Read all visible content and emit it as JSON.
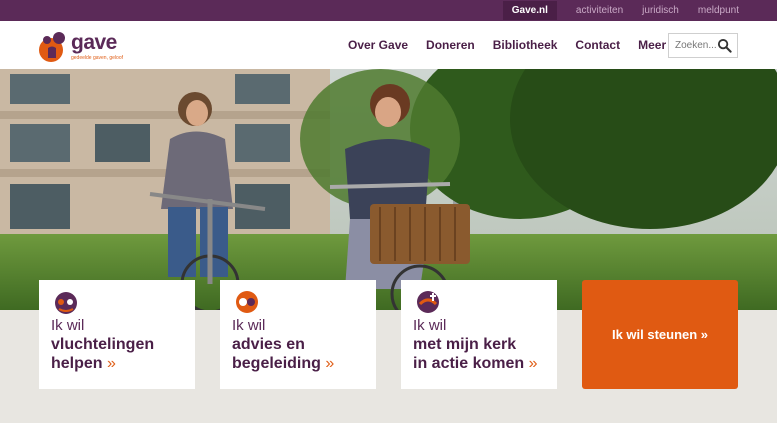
{
  "topbar": {
    "links": [
      "Gave.nl",
      "activiteiten",
      "juridisch",
      "meldpunt"
    ]
  },
  "logo": {
    "name": "gave",
    "tagline": "gedeelde gaven, geloof"
  },
  "nav": {
    "items": [
      "Over Gave",
      "Doneren",
      "Bibliotheek",
      "Contact",
      "Meer"
    ]
  },
  "search": {
    "placeholder": "Zoeken..."
  },
  "cards": [
    {
      "pre": "Ik wil",
      "line1": "vluchtelingen",
      "line2": "helpen",
      "arrow": "»"
    },
    {
      "pre": "Ik wil",
      "line1": "advies en",
      "line2": "begeleiding",
      "arrow": "»"
    },
    {
      "pre": "Ik wil",
      "line1": "met mijn kerk",
      "line2": "in actie komen",
      "arrow": "»"
    }
  ],
  "cta": {
    "label": "Ik wil steunen »"
  },
  "colors": {
    "brand_purple": "#5b2a58",
    "brand_orange": "#e05a12"
  }
}
